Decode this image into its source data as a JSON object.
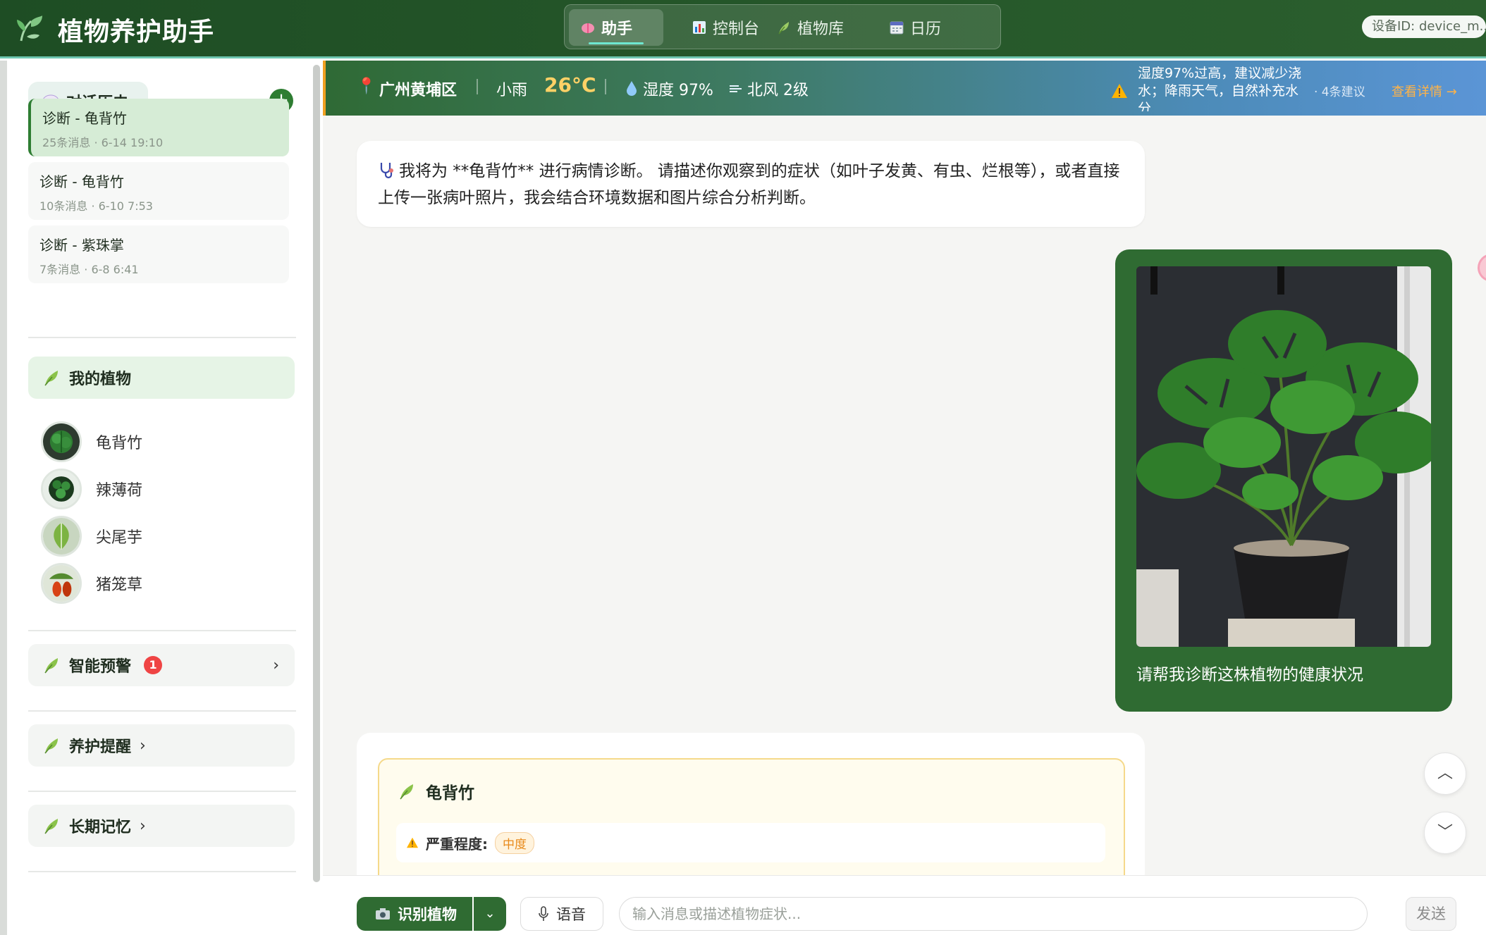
{
  "app": {
    "title": "植物养护助手",
    "device_id": "设备ID: device_m..."
  },
  "nav": {
    "tabs": [
      {
        "label": "助手",
        "icon": "brain-icon",
        "active": true
      },
      {
        "label": "控制台",
        "icon": "bar-chart-icon"
      },
      {
        "label": "植物库",
        "icon": "leaf-icon"
      },
      {
        "label": "日历",
        "icon": "calendar-icon"
      }
    ]
  },
  "sidebar": {
    "history_title": "对话历史",
    "history": [
      {
        "title": "诊断 - 龟背竹",
        "meta": "25条消息 · 6-14 19:10",
        "active": true
      },
      {
        "title": "诊断 - 龟背竹",
        "meta": "10条消息 · 6-10 7:53"
      },
      {
        "title": "诊断 - 紫珠掌",
        "meta": "7条消息 · 6-8 6:41"
      }
    ],
    "plants_title": "我的植物",
    "plants": [
      {
        "name": "龟背竹",
        "icon": "monstera-avatar"
      },
      {
        "name": "辣薄荷",
        "icon": "mint-avatar"
      },
      {
        "name": "尖尾芋",
        "icon": "alocasia-avatar"
      },
      {
        "name": "猪笼草",
        "icon": "nepenthes-avatar"
      }
    ],
    "alerts_title": "智能预警",
    "alerts_count": "1",
    "reminders_title": "养护提醒",
    "memory_title": "长期记忆"
  },
  "weather": {
    "location": "广州黄埔区",
    "condition": "小雨",
    "temperature": "26°C",
    "humidity": "湿度 97%",
    "wind": "北风 2级",
    "advice": "湿度97%过高，建议减少浇水；降雨天气，自然补充水分",
    "advice_count": "· 4条建议",
    "details_link": "查看详情 →"
  },
  "chat": {
    "bot_message": "我将为 **龟背竹** 进行病情诊断。 请描述你观察到的症状（如叶子发黄、有虫、烂根等），或者直接上传一张病叶照片，我会结合环境数据和图片综合分析判断。",
    "user_message": "请帮我诊断这株植物的健康状况",
    "diagnosis": {
      "plant": "龟背竹",
      "severity_label": "严重程度:",
      "severity": "中度"
    }
  },
  "input": {
    "identify_label": "识别植物",
    "voice_label": "语音",
    "placeholder": "输入消息或描述植物症状...",
    "send_label": "发送"
  },
  "colors": {
    "primary": "#2e7d32",
    "header": "#1e4d24",
    "accent": "#f0a020",
    "alert": "#ef4444"
  }
}
